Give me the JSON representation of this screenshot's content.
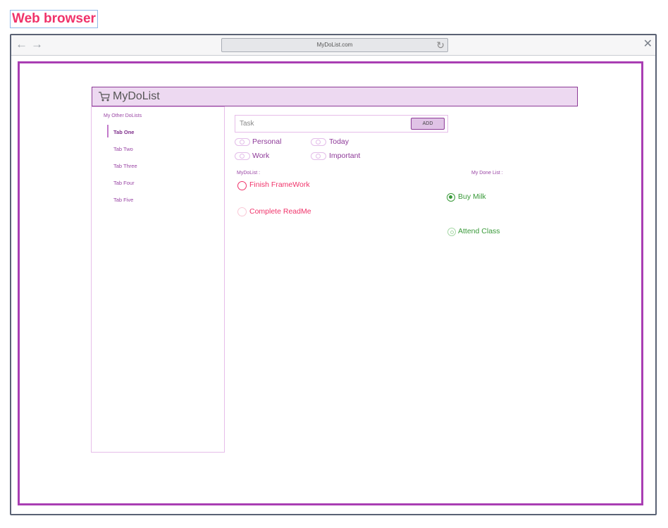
{
  "wireframe_label": "Web browser",
  "browser": {
    "url": "MyDoList.com",
    "back_icon": "arrow-left-icon",
    "forward_icon": "arrow-right-icon",
    "reload_icon": "reload-icon",
    "close_icon": "close-icon"
  },
  "app": {
    "title": "MyDoList",
    "logo_icon": "cart-icon",
    "accent_color": "#a93eb3",
    "header_bg": "#edd9f1"
  },
  "sidebar": {
    "title": "My Other DoLists",
    "items": [
      {
        "label": "Tab One",
        "active": true
      },
      {
        "label": "Tab Two",
        "active": false
      },
      {
        "label": "Tab Three",
        "active": false
      },
      {
        "label": "Tab Four",
        "active": false
      },
      {
        "label": "Tab Five",
        "active": false
      }
    ]
  },
  "task_entry": {
    "placeholder": "Task",
    "value": "",
    "add_label": "ADD"
  },
  "categories": [
    {
      "label": "Personal",
      "on": false
    },
    {
      "label": "Today",
      "on": false
    },
    {
      "label": "Work",
      "on": false
    },
    {
      "label": "Important",
      "on": false
    }
  ],
  "todo_list": {
    "title": "MyDoList :",
    "text_color": "#f0336a",
    "items": [
      {
        "label": "Finish FrameWork",
        "selected": true
      },
      {
        "label": "Complete ReadMe",
        "selected": false
      }
    ]
  },
  "done_list": {
    "title": "My Done List :",
    "text_color": "#3a9a3a",
    "items": [
      {
        "label": "Buy Milk",
        "selected": true
      },
      {
        "label": "Attend Class",
        "selected": false
      }
    ]
  }
}
